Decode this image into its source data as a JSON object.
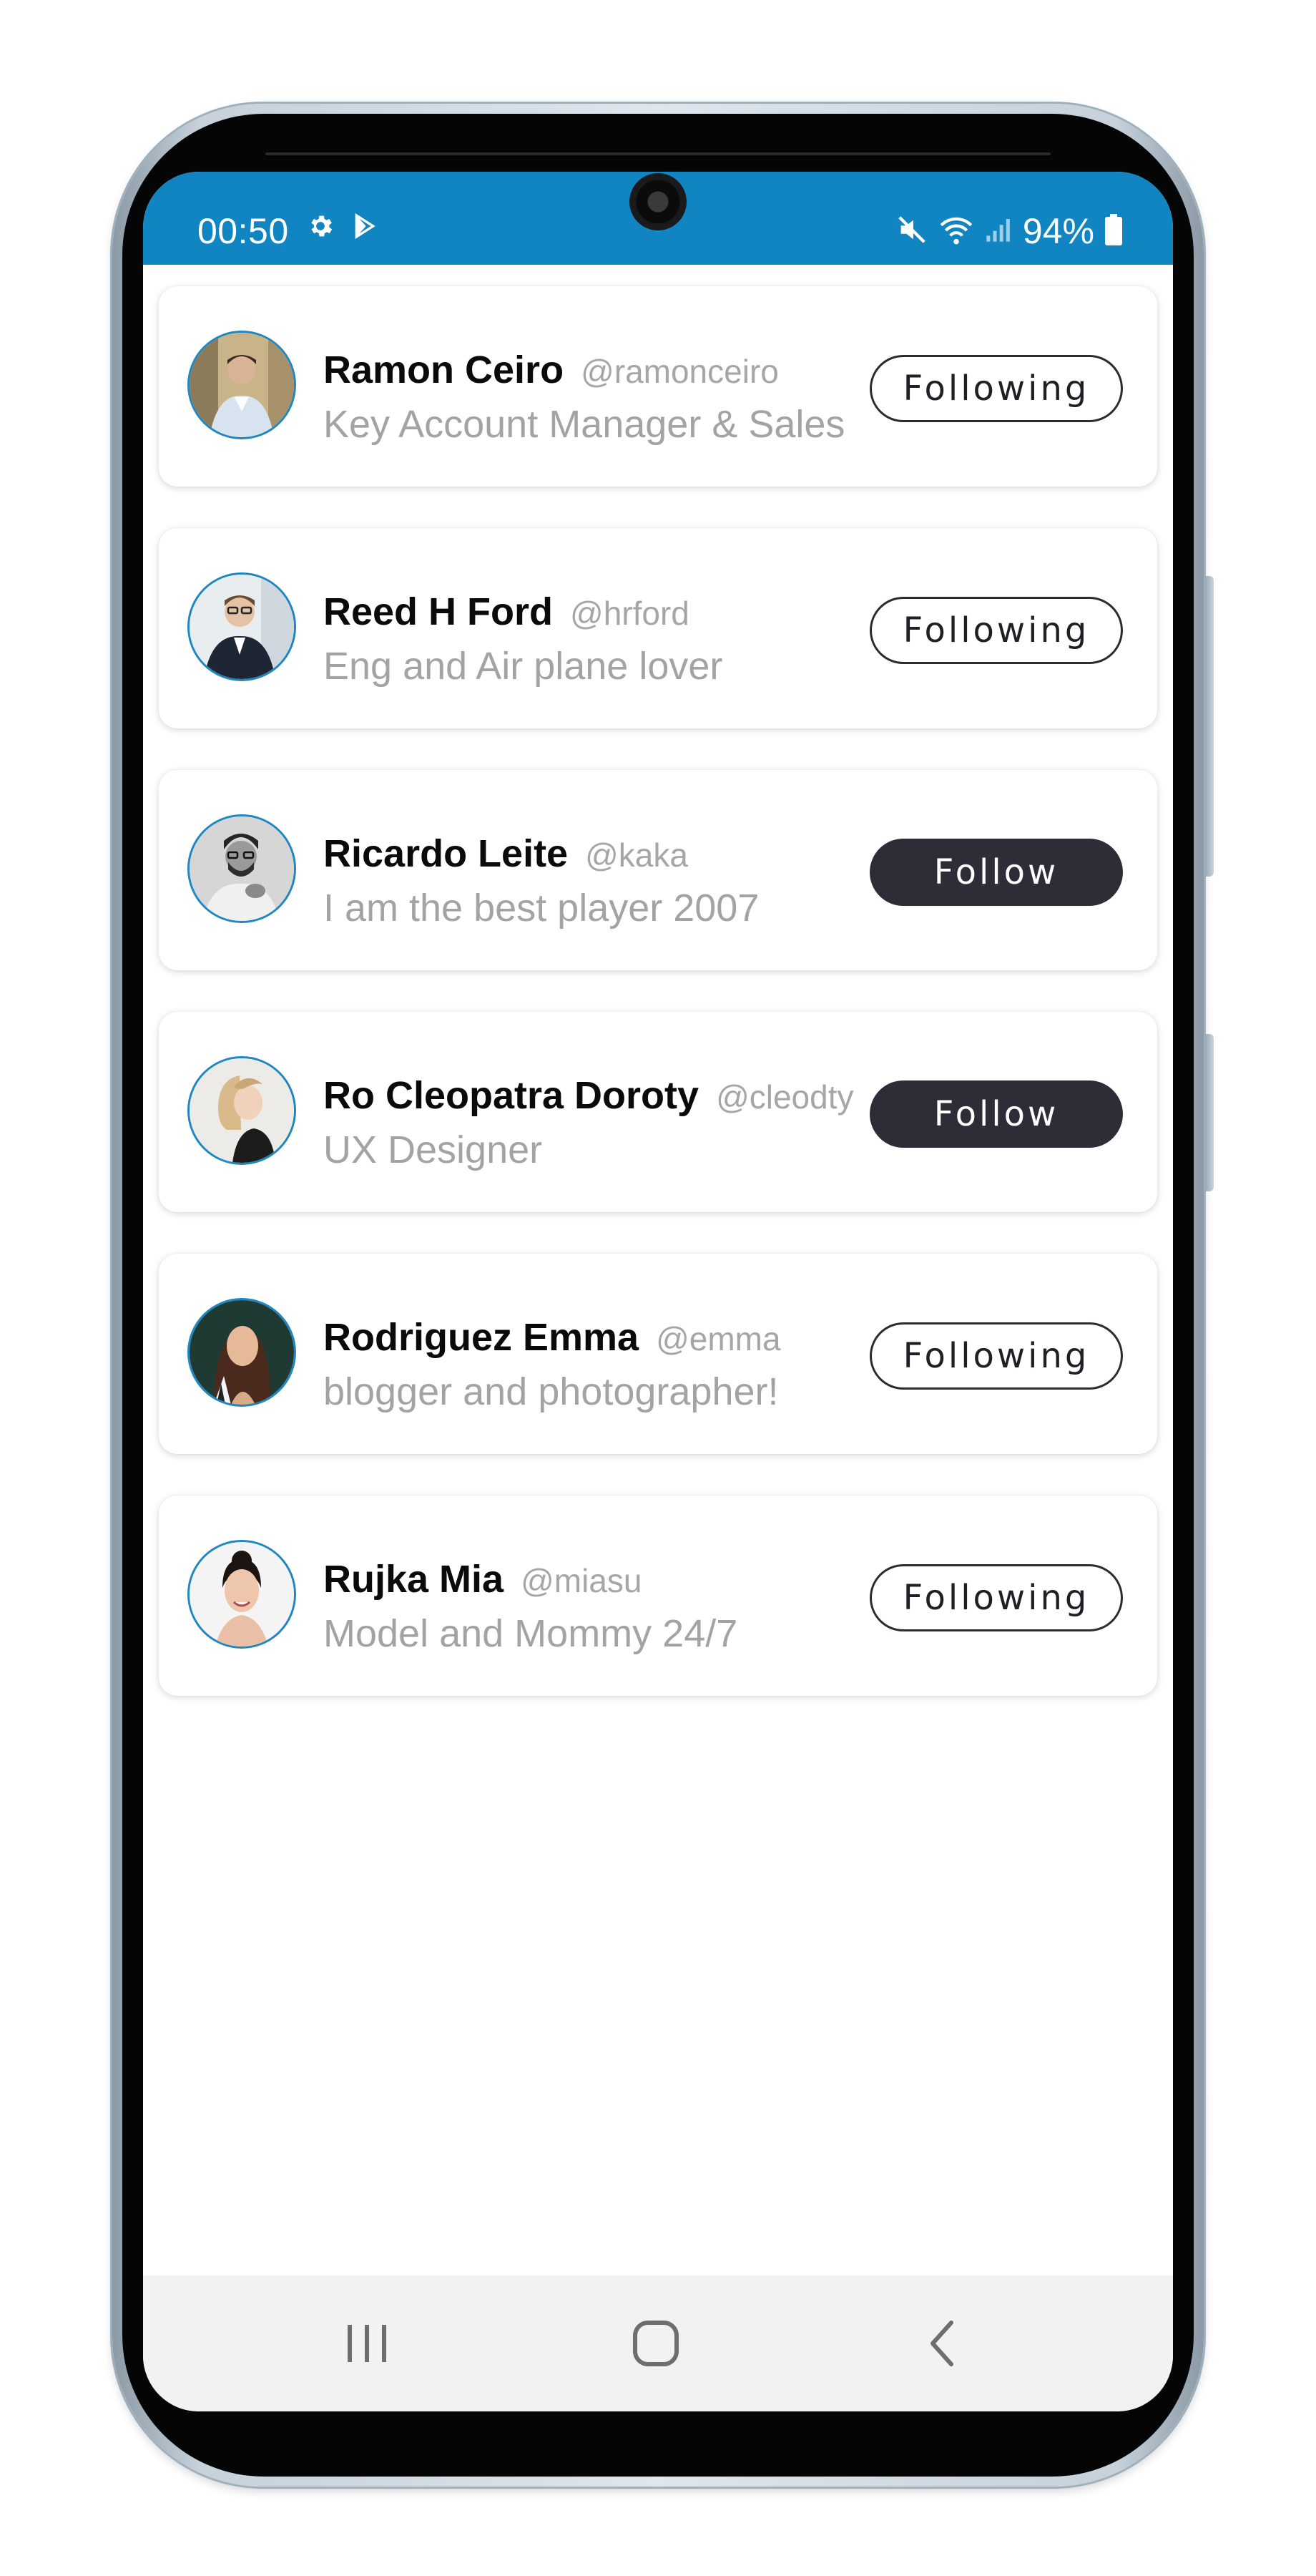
{
  "status_bar": {
    "time": "00:50",
    "battery": "94%",
    "icons_left": [
      "gear-icon",
      "play-store-icon"
    ],
    "icons_right": [
      "mute-icon",
      "wifi-icon",
      "signal-icon",
      "battery-icon"
    ],
    "background_color": "#1185c2"
  },
  "users": [
    {
      "name": "Ramon Ceiro",
      "handle": "@ramonceiro",
      "bio": "Key Account Manager & Sales",
      "button": "Following",
      "following": true
    },
    {
      "name": "Reed H Ford",
      "handle": "@hrford",
      "bio": "Eng and Air plane lover",
      "button": "Following",
      "following": true
    },
    {
      "name": "Ricardo Leite",
      "handle": "@kaka",
      "bio": "I am the best player 2007",
      "button": "Follow",
      "following": false
    },
    {
      "name": "Ro Cleopatra Doroty",
      "handle": "@cleodty",
      "bio": "UX Designer",
      "button": "Follow",
      "following": false
    },
    {
      "name": "Rodriguez Emma",
      "handle": "@emma",
      "bio": "blogger and photographer!",
      "button": "Following",
      "following": true
    },
    {
      "name": "Rujka Mia",
      "handle": "@miasu",
      "bio": "Model and Mommy 24/7",
      "button": "Following",
      "following": true
    }
  ],
  "nav_bar": {
    "items": [
      "recent-apps-icon",
      "home-icon",
      "back-icon"
    ]
  },
  "colors": {
    "accent": "#1185c2",
    "follow_button": "#2c2d37",
    "avatar_ring": "#1f86bf"
  }
}
